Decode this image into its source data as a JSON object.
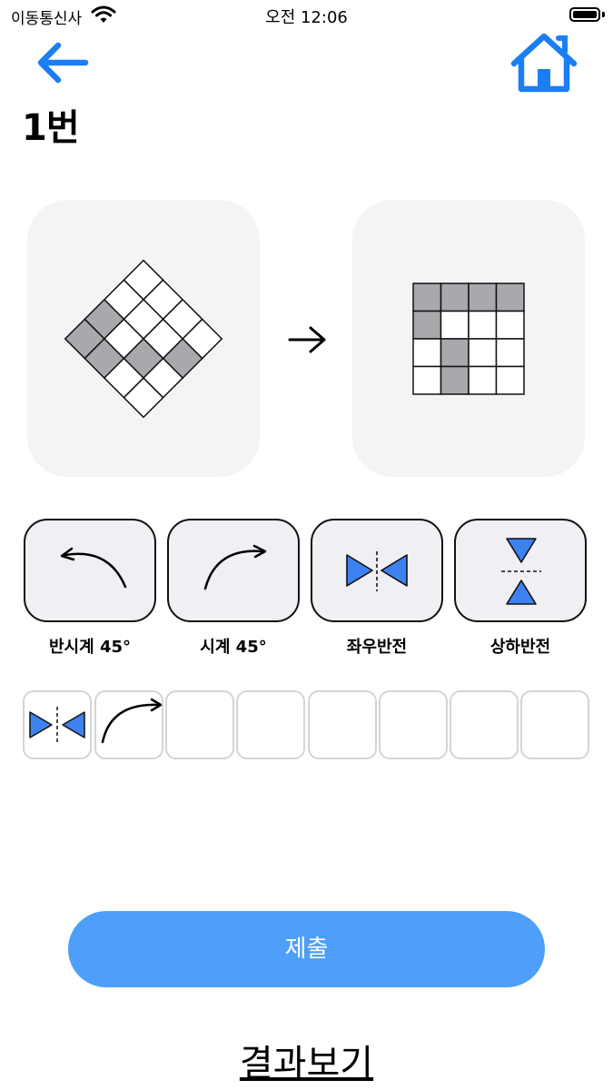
{
  "status_bar": {
    "carrier": "이동통신사",
    "time": "오전 12:06"
  },
  "header": {
    "back_icon": "arrow-left-icon",
    "home_icon": "home-icon",
    "title": "1번"
  },
  "colors": {
    "accent": "#1a7ef5",
    "submit_bg": "#4d9ffa",
    "cell_filled": "#a9a9ad",
    "triangle_blue": "#3d82f0"
  },
  "puzzle": {
    "source_grid": [
      [
        0,
        0,
        0,
        0
      ],
      [
        0,
        0,
        0,
        1
      ],
      [
        1,
        0,
        1,
        0
      ],
      [
        1,
        1,
        0,
        0
      ]
    ],
    "target_grid": [
      [
        1,
        1,
        1,
        1
      ],
      [
        1,
        0,
        0,
        0
      ],
      [
        0,
        1,
        0,
        0
      ],
      [
        0,
        1,
        0,
        0
      ]
    ],
    "arrow_icon": "arrow-right-icon"
  },
  "operations": [
    {
      "label": "반시계 45°",
      "icon": "counterclockwise-arrow-icon"
    },
    {
      "label": "시계 45°",
      "icon": "clockwise-arrow-icon"
    },
    {
      "label": "좌우반전",
      "icon": "flip-horizontal-icon"
    },
    {
      "label": "상하반전",
      "icon": "flip-vertical-icon"
    }
  ],
  "sequence": [
    "flip-horizontal-icon",
    "clockwise-arrow-icon",
    "",
    "",
    "",
    "",
    "",
    ""
  ],
  "submit_label": "제출",
  "results_label": "결과보기"
}
